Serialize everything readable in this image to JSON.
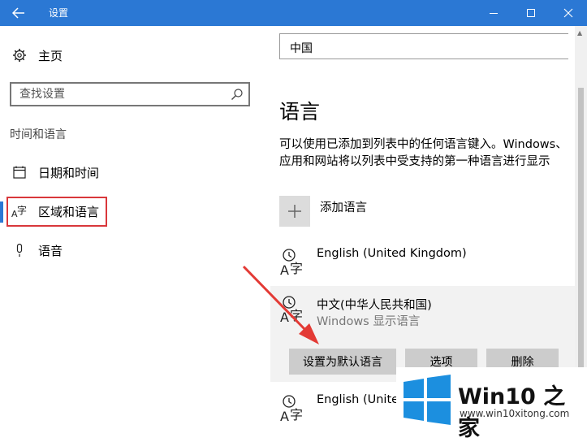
{
  "window": {
    "title": "设置"
  },
  "nav": {
    "home_label": "主页",
    "search_placeholder": "查找设置",
    "section_header": "时间和语言",
    "items": [
      {
        "label": "日期和时间"
      },
      {
        "label": "区域和语言",
        "selected": true
      },
      {
        "label": "语音"
      }
    ]
  },
  "region": {
    "country_value": "中国"
  },
  "language": {
    "heading": "语言",
    "description": "可以使用已添加到列表中的任何语言键入。Windows、应用和网站将以列表中受支持的第一种语言进行显示",
    "add_label": "添加语言",
    "entries": [
      {
        "name": "English (United Kingdom)"
      },
      {
        "name": "中文(中华人民共和国)",
        "subtitle": "Windows 显示语言"
      },
      {
        "name": "English (United"
      }
    ],
    "buttons": {
      "set_default": "设置为默认语言",
      "options": "选项",
      "remove": "删除"
    }
  },
  "watermark": {
    "brand": "Win10 之家",
    "url": "www.win10xitong.com"
  },
  "colors": {
    "accent": "#2b78d4",
    "highlight": "#d9373b",
    "button": "#cccccc"
  }
}
